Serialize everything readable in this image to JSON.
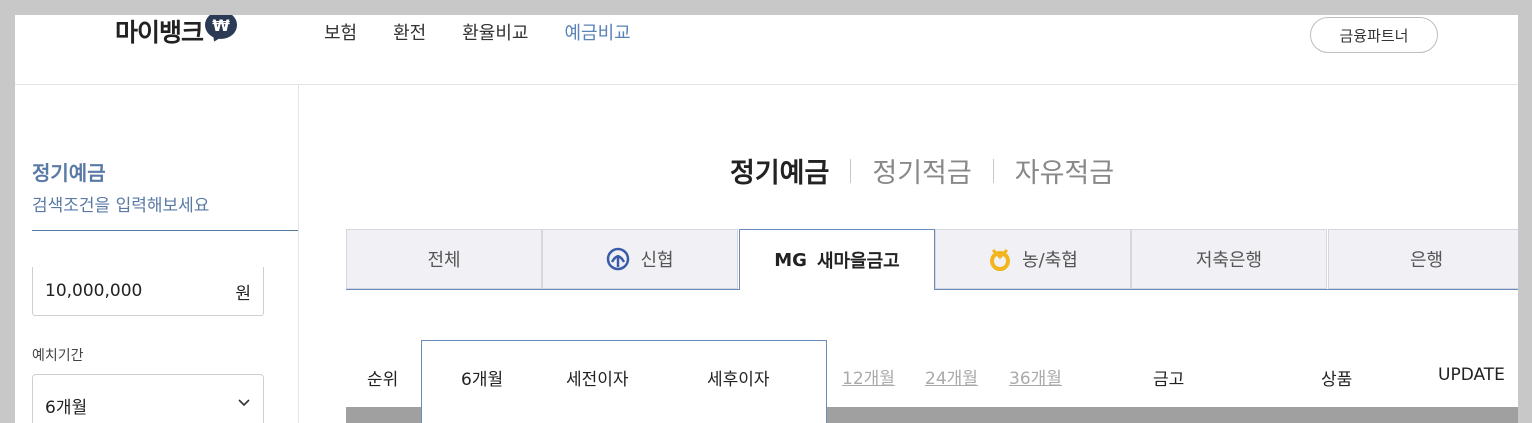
{
  "header": {
    "logo_text": "마이뱅크",
    "logo_badge": "₩",
    "nav": [
      {
        "label": "보험",
        "active": false
      },
      {
        "label": "환전",
        "active": false
      },
      {
        "label": "환율비교",
        "active": false
      },
      {
        "label": "예금비교",
        "active": true
      }
    ],
    "partner_button": "금융파트너"
  },
  "sidebar": {
    "title": "정기예금",
    "subtitle": "검색조건을 입력해보세요",
    "amount_value": "10,000,000",
    "amount_unit": "원",
    "period_label": "예치기간",
    "period_value": "6개월"
  },
  "main": {
    "categories": [
      {
        "label": "정기예금",
        "active": true
      },
      {
        "label": "정기적금",
        "active": false
      },
      {
        "label": "자유적금",
        "active": false
      }
    ],
    "institution_tabs": [
      {
        "label": "전체",
        "icon": "none",
        "active": false
      },
      {
        "label": "신협",
        "icon": "shinhyup-logo-icon",
        "active": false
      },
      {
        "label": "새마을금고",
        "prefix": "MG",
        "icon": "mg-logo",
        "active": true
      },
      {
        "label": "농/축협",
        "icon": "nonghyup-logo-icon",
        "active": false
      },
      {
        "label": "저축은행",
        "icon": "none",
        "active": false
      },
      {
        "label": "은행",
        "icon": "none",
        "active": false
      }
    ],
    "table_headers": {
      "rank": "순위",
      "period_6": "6개월",
      "pre_tax": "세전이자",
      "after_tax": "세후이자",
      "period_12": "12개월",
      "period_24": "24개월",
      "period_36": "36개월",
      "bank": "금고",
      "product": "상품",
      "update": "UPDATE"
    }
  },
  "colors": {
    "accent": "#5a84b6",
    "tab_border_active": "#6a8cbc",
    "tab_bg": "#f1f1f5",
    "logo_badge": "#2b3a55",
    "nonghyup_gold": "#f3b51d",
    "shinhyup_blue": "#3b5ba9"
  }
}
